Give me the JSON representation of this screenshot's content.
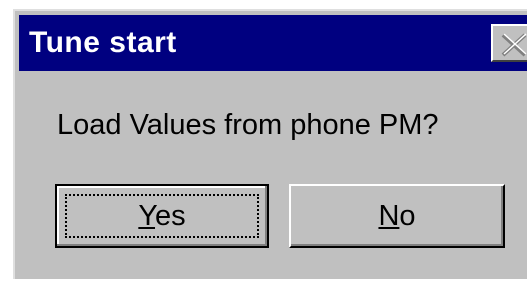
{
  "dialog": {
    "title": "Tune start",
    "message": "Load Values from phone PM?",
    "close_icon": "close-icon",
    "buttons": {
      "yes": {
        "accel": "Y",
        "rest": "es",
        "default": true
      },
      "no": {
        "accel": "N",
        "rest": "o",
        "default": false
      }
    }
  },
  "colors": {
    "titlebar": "#000080",
    "title_text": "#ffffff",
    "face": "#c0c0c0"
  }
}
